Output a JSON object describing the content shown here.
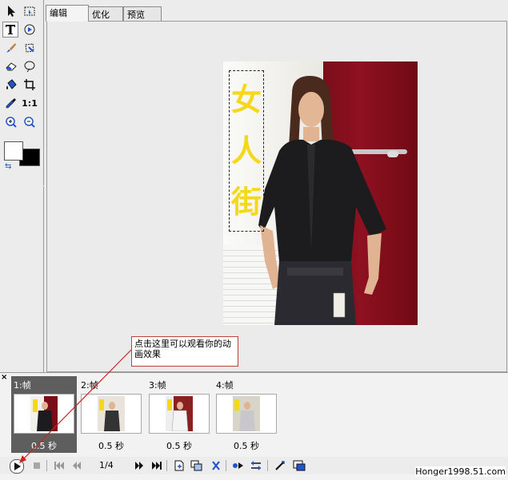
{
  "tabs": [
    {
      "label": "编辑"
    },
    {
      "label": "优化"
    },
    {
      "label": "预览"
    }
  ],
  "image_text": [
    "女",
    "人",
    "街"
  ],
  "callout": {
    "text": "点击这里可以观看你的动画效果"
  },
  "frames": [
    {
      "label": "1:帧",
      "delay": "0.5 秒"
    },
    {
      "label": "2:帧",
      "delay": "0.5 秒"
    },
    {
      "label": "3:帧",
      "delay": "0.5 秒"
    },
    {
      "label": "4:帧",
      "delay": "0.5 秒"
    }
  ],
  "controls": {
    "counter": "1/4",
    "zoom_ratio": "1:1"
  },
  "panel_close": "×",
  "watermark": "Honger1998.51.com",
  "colors": {
    "text_color": "#f5d81a",
    "fg_swatch": "#ffffff",
    "bg_swatch": "#000000",
    "callout_border": "#c04040"
  },
  "icons": [
    "arrow-pointer-icon",
    "select-slice-icon",
    "text-tool-icon",
    "shape-tool-icon",
    "brush-icon",
    "lasso-icon",
    "eraser-icon",
    "ellipse-select-icon",
    "paint-bucket-icon",
    "crop-icon",
    "eyedropper-icon",
    "actual-size-icon",
    "zoom-in-icon",
    "zoom-out-icon"
  ]
}
